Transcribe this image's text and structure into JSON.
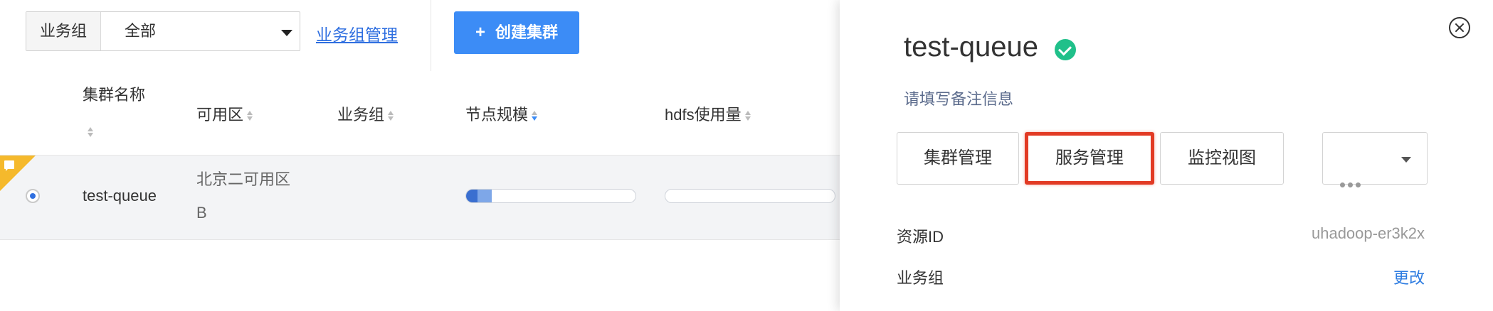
{
  "toolbar": {
    "group_label": "业务组",
    "group_value": "全部",
    "manage_link": "业务组管理",
    "create_plus": "+",
    "create_label": "创建集群"
  },
  "table": {
    "columns": {
      "name": "集群名称",
      "zone": "可用区",
      "group": "业务组",
      "nodes": "节点规模",
      "hdfs": "hdfs使用量"
    },
    "row": {
      "name": "test-queue",
      "zone_line1": "北京二可用区",
      "zone_line2": "B",
      "node_usage": 0.15,
      "hdfs_usage": 0.0
    }
  },
  "panel": {
    "title": "test-queue",
    "remark": "请填写备注信息",
    "tabs": {
      "cluster": "集群管理",
      "service": "服务管理",
      "monitor": "监控视图"
    },
    "info": {
      "resource_id_label": "资源ID",
      "resource_id_value": "uhadoop-er3k2x",
      "group_label": "业务组",
      "group_action": "更改"
    }
  },
  "colors": {
    "primary": "#3c8cf6",
    "link": "#2f6fe0",
    "success": "#20c08a",
    "highlight": "#e23b25",
    "flag": "#f5b92c"
  }
}
